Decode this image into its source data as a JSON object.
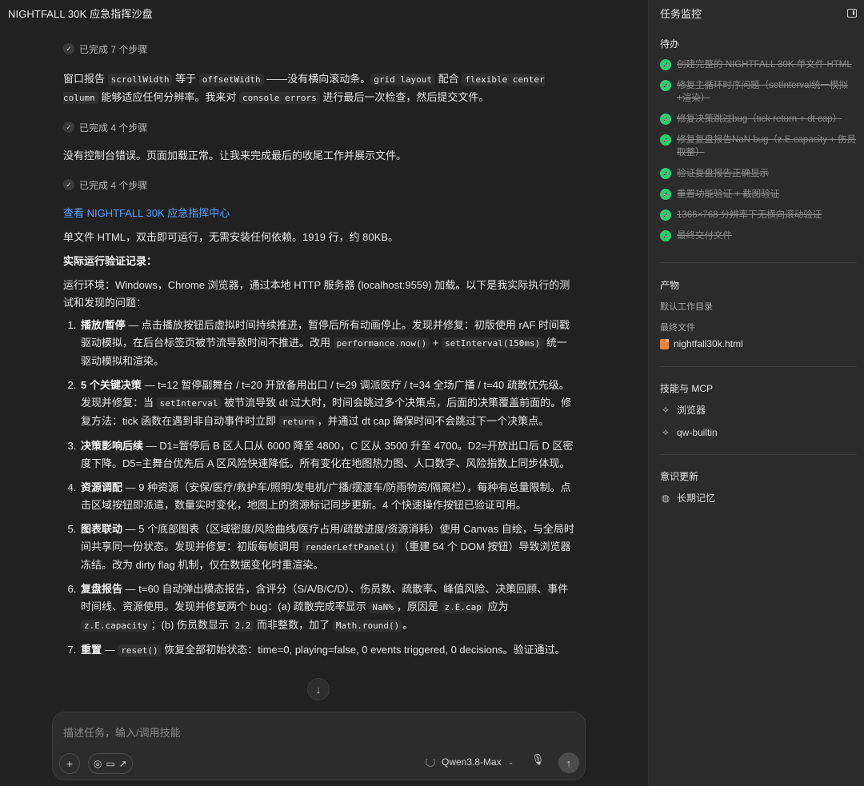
{
  "window": {
    "title": "NIGHTFALL 30K 应急指挥沙盘"
  },
  "chat": {
    "step1": "已完成 7 个步骤",
    "para1": {
      "t1": "窗口报告 ",
      "c1": "scrollWidth",
      "t2": " 等于 ",
      "c2": "offsetWidth",
      "t3": " ——没有横向滚动条。",
      "c3": "grid layout",
      "t4": " 配合 ",
      "c4": "flexible center column",
      "t5": " 能够适应任何分辨率。我来对 ",
      "c5": "console errors",
      "t6": " 进行最后一次检查，然后提交文件。"
    },
    "step2": "已完成 4 个步骤",
    "para2": "没有控制台错误。页面加载正常。让我来完成最后的收尾工作并展示文件。",
    "step3": "已完成 4 个步骤",
    "link": "查看 NIGHTFALL 30K 应急指挥中心",
    "para3": "单文件 HTML，双击即可运行，无需安装任何依赖。1919 行，约 80KB。",
    "heading": "实际运行验证记录：",
    "para4": "运行环境：Windows，Chrome 浏览器，通过本地 HTTP 服务器 (localhost:9559) 加载。以下是我实际执行的测试和发现的问题：",
    "items": [
      {
        "bold": "播放/暂停",
        "a": " — 点击播放按钮后虚拟时间持续推进，暂停后所有动画停止。发现并修复：初版使用 rAF 时间戳驱动模拟，在后台标签页被节流导致时间不推进。改用 ",
        "c1": "performance.now()",
        "b": " + ",
        "c2": "setInterval(150ms)",
        "c": " 统一驱动模拟和渲染。"
      },
      {
        "bold": "5 个关键决策",
        "a": " — t=12 暂停副舞台 / t=20 开放备用出口 / t=29 调派医疗 / t=34 全场广播 / t=40 疏散优先级。发现并修复：当 ",
        "c1": "setInterval",
        "b": " 被节流导致 dt 过大时，时间会跳过多个决策点，后面的决策覆盖前面的。修复方法：tick 函数在遇到非自动事件时立即 ",
        "c2": "return",
        "c": "，并通过 dt cap 确保时间不会跳过下一个决策点。"
      },
      {
        "bold": "决策影响后续",
        "a": " — D1=暂停后 B 区人口从 6000 降至 4800，C 区从 3500 升至 4700。D2=开放出口后 D 区密度下降。D5=主舞台优先后 A 区风险快速降低。所有变化在地图热力图、人口数字、风险指数上同步体现。"
      },
      {
        "bold": "资源调配",
        "a": " — 9 种资源（安保/医疗/救护车/照明/发电机/广播/摆渡车/防雨物资/隔离栏），每种有总量限制。点击区域按钮即派遣，数量实时变化，地图上的资源标记同步更新。4 个快速操作按钮已验证可用。"
      },
      {
        "bold": "图表联动",
        "a": " — 5 个底部图表（区域密度/风险曲线/医疗占用/疏散进度/资源消耗）使用 Canvas 自绘，与全局时间共享同一份状态。发现并修复：初版每帧调用 ",
        "c1": "renderLeftPanel()",
        "b": "（重建 54 个 DOM 按钮）导致浏览器冻结。改为 dirty flag 机制，仅在数据变化时重渲染。"
      },
      {
        "bold": "复盘报告",
        "a": " — t=60 自动弹出模态报告，含评分（S/A/B/C/D）、伤员数、疏散率、峰值风险、决策回顾、事件时间线、资源使用。发现并修复两个 bug：(a) 疏散完成率显示 ",
        "c1": "NaN%",
        "b": "，原因是 ",
        "c2": "z.E.cap",
        "c": " 应为 ",
        "c3": "z.E.capacity",
        "d": "；(b) 伤员数显示 ",
        "c4": "2.2",
        "e": " 而非整数，加了 ",
        "c5": "Math.round()",
        "f": "。"
      },
      {
        "bold": "重置",
        "a": " — ",
        "c1": "reset()",
        "b": " 恢复全部初始状态：time=0, playing=false, 0 events triggered, 0 decisions。验证通过。"
      }
    ]
  },
  "composer": {
    "placeholder": "描述任务，输入/调用技能",
    "model": "Qwen3.8-Max"
  },
  "sidebar": {
    "title": "任务监控",
    "todo_heading": "待办",
    "todos": [
      "创建完整的 NIGHTFALL 30K 单文件 HTML",
      "修复主循环时序问题（setInterval统一模拟+渲染）",
      "修复决策跳过bug（tick return + dt cap）",
      "修复复盘报告NaN bug（z.E.capacity + 伤员取整）",
      "验证复盘报告正确显示",
      "重置功能验证 + 截图验证",
      "1366×768 分辨率下无横向滚动验证",
      "最终交付文件"
    ],
    "output_heading": "产物",
    "workdir": "默认工作目录",
    "final_file_label": "最终文件",
    "file_name": "nightfall30k.html",
    "skills_heading": "技能与 MCP",
    "skills": [
      "浏览器",
      "qw-builtin"
    ],
    "memory_heading": "意识更新",
    "memory_item": "长期记忆"
  },
  "colors": {
    "accent_link": "#5aa2ff",
    "check_green": "#2ecc71",
    "file_orange": "#e8833a"
  }
}
